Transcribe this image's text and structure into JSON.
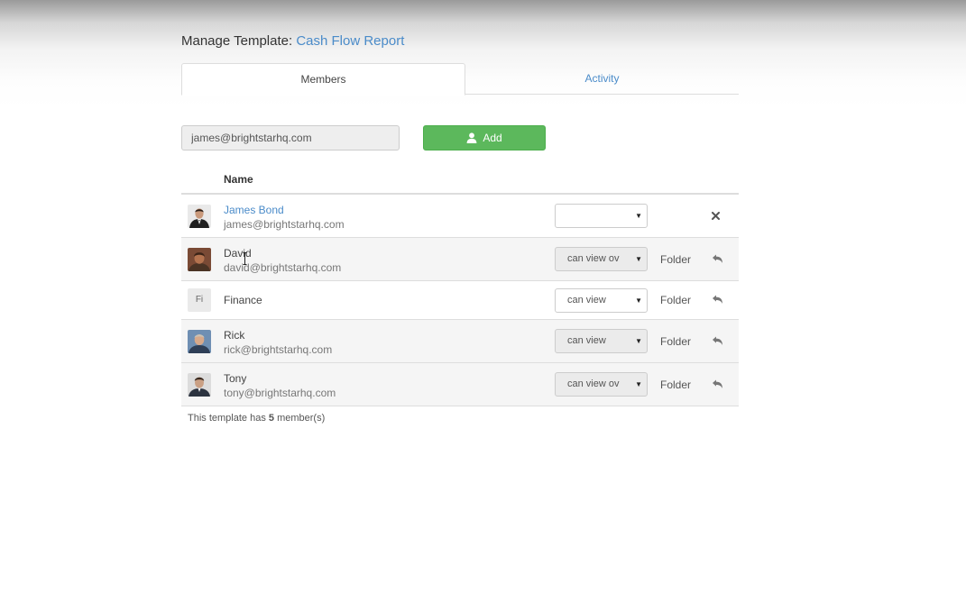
{
  "header": {
    "prefix": "Manage Template:",
    "template_name": "Cash Flow Report"
  },
  "tabs": [
    {
      "label": "Members",
      "active": true
    },
    {
      "label": "Activity",
      "active": false
    }
  ],
  "add_member": {
    "email_value": "james@brightstarhq.com",
    "add_label": "Add",
    "add_icon": "user-icon"
  },
  "table": {
    "column_name": "Name",
    "rows": [
      {
        "name": "James Bond",
        "email": "james@brightstarhq.com",
        "permission": "",
        "scope": "",
        "action_icon": "remove-icon"
      },
      {
        "name": "David",
        "email": "david@brightstarhq.com",
        "permission": "can view ov",
        "scope": "Folder",
        "action_icon": "undo-icon"
      },
      {
        "name": "Finance",
        "initials": "Fi",
        "permission": "can view",
        "scope": "Folder",
        "action_icon": "undo-icon"
      },
      {
        "name": "Rick",
        "email": "rick@brightstarhq.com",
        "permission": "can view",
        "scope": "Folder",
        "action_icon": "undo-icon"
      },
      {
        "name": "Tony",
        "email": "tony@brightstarhq.com",
        "permission": "can view ov",
        "scope": "Folder",
        "action_icon": "undo-icon"
      }
    ]
  },
  "footer": {
    "prefix": "This template has",
    "count": "5",
    "suffix": "member(s)"
  },
  "colors": {
    "link": "#4a8bc9",
    "add_button": "#5cb85c",
    "row_shade": "#f5f5f5",
    "border": "#dddddd"
  }
}
